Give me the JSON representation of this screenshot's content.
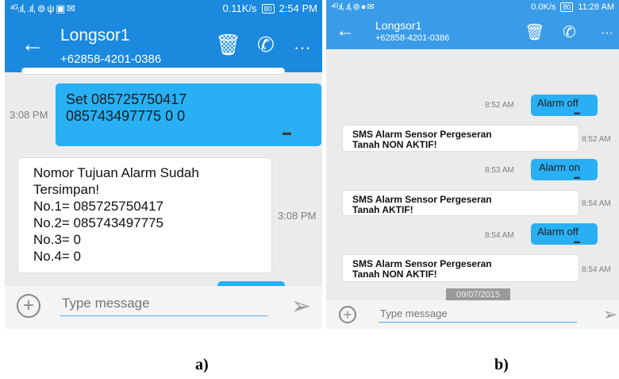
{
  "panel_a": {
    "status": {
      "signal": "⁴ᴳ.ıl, .ıl, ⊚ ψ ▣ ✉",
      "speed": "0.11K/s",
      "battery": "80",
      "time": "2:54 PM"
    },
    "header": {
      "contact": "Longsor1",
      "number": "+62858-4201-0386"
    },
    "messages": [
      {
        "line1": "Set 085725750417",
        "line2": "085743497775 0 0",
        "time": "3:08 PM"
      },
      {
        "lines": [
          "Nomor Tujuan Alarm Sudah",
          "Tersimpan!",
          "No.1= 085725750417",
          "No.2= 085743497775",
          "No.3= 0",
          "No.4= 0"
        ],
        "time": "3:08 PM"
      }
    ],
    "input": {
      "placeholder": "Type message"
    }
  },
  "panel_b": {
    "status": {
      "signal": "⁴ᴳ.ıl, .ıl, ⊚ ● ✉",
      "speed": "0.0K/s",
      "battery": "80",
      "time": "11:28 AM"
    },
    "header": {
      "contact": "Longsor1",
      "number": "+62858-4201-0386"
    },
    "messages": [
      {
        "text": "Alarm off",
        "time": "8:52 AM"
      },
      {
        "line1": "SMS Alarm Sensor Pergeseran",
        "line2": "Tanah NON AKTIF!",
        "time": "8:52 AM"
      },
      {
        "text": "Alarm on",
        "time": "8:53 AM"
      },
      {
        "line1": "SMS Alarm Sensor Pergeseran",
        "line2": "Tanah AKTIF!",
        "time": "8:54 AM"
      },
      {
        "text": "Alarm off",
        "time": "8:54 AM"
      },
      {
        "line1": "SMS Alarm Sensor Pergeseran",
        "line2": "Tanah NON AKTIF!",
        "time": "8:54 AM"
      }
    ],
    "date_chip": "09/07/2015",
    "input": {
      "placeholder": "Type message"
    }
  },
  "captions": {
    "a": "a)",
    "b": "b)"
  },
  "colors": {
    "app_bar": "#1a89de",
    "outgoing_bubble": "#29b0f4",
    "chat_bg": "#ebebeb"
  }
}
